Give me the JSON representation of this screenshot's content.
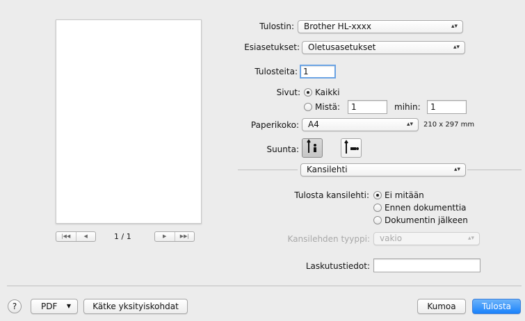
{
  "preview": {
    "page_indicator": "1 / 1",
    "nav_first_icon": "first-page-icon",
    "nav_prev_icon": "previous-page-icon",
    "nav_next_icon": "next-page-icon",
    "nav_last_icon": "last-page-icon"
  },
  "printer": {
    "label": "Tulostin:",
    "value": "Brother HL-xxxx"
  },
  "presets": {
    "label": "Esiasetukset:",
    "value": "Oletusasetukset"
  },
  "copies": {
    "label": "Tulosteita:",
    "value": "1"
  },
  "pages": {
    "label": "Sivut:",
    "all_label": "Kaikki",
    "all_selected": true,
    "from_label": "Mistä:",
    "from_value": "1",
    "to_label": "mihin:",
    "to_value": "1"
  },
  "paper_size": {
    "label": "Paperikoko:",
    "value": "A4",
    "dimensions": "210 x 297 mm"
  },
  "orientation": {
    "label": "Suunta:",
    "selected": "portrait"
  },
  "section_popup": {
    "value": "Kansilehti"
  },
  "cover": {
    "label": "Tulosta kansilehti:",
    "options": [
      "Ei mitään",
      "Ennen dokumenttia",
      "Dokumentin jälkeen"
    ],
    "selected_index": 0,
    "type_label": "Kansilehden tyyppi:",
    "type_value": "vakio",
    "billing_label": "Laskutustiedot:",
    "billing_value": ""
  },
  "footer": {
    "help_label": "?",
    "pdf_label": "PDF",
    "hide_details_label": "Kätke yksityiskohdat",
    "cancel_label": "Kumoa",
    "print_label": "Tulosta"
  },
  "colors": {
    "accent": "#1a82fb",
    "background": "#ececec"
  }
}
